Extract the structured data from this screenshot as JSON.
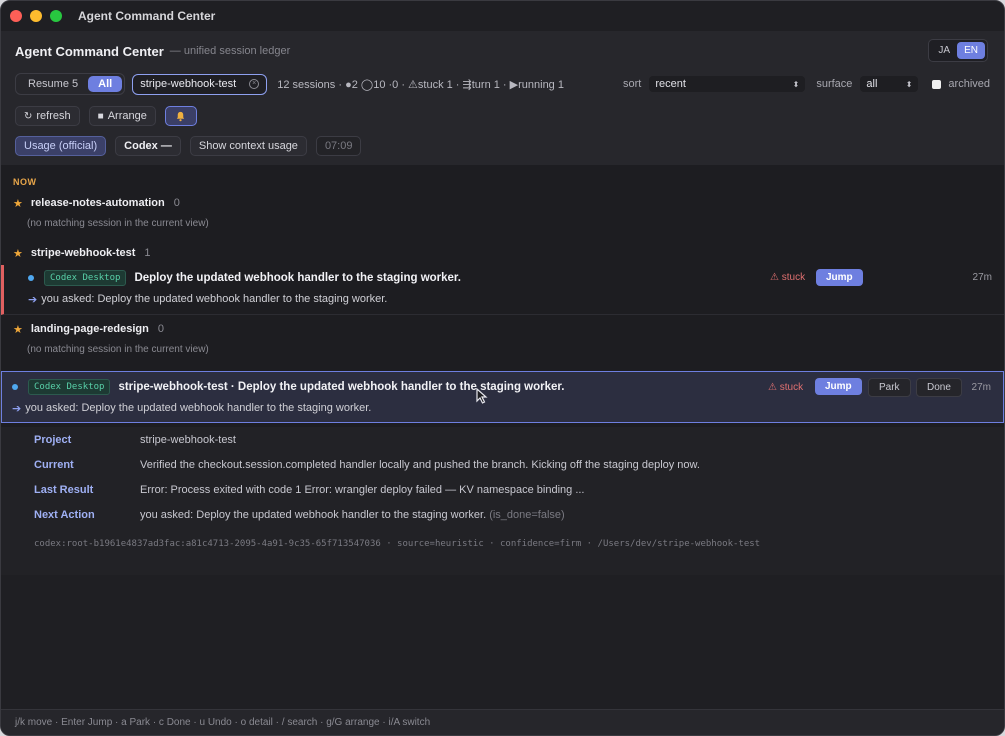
{
  "window": {
    "title": "Agent Command Center"
  },
  "header": {
    "title": "Agent Command Center",
    "subtitle": "— unified session ledger",
    "lang": [
      "JA",
      "EN"
    ],
    "lang_active": "EN"
  },
  "filters": {
    "resume_label": "Resume 5",
    "all_label": "All",
    "search_value": "stripe-webhook-test",
    "stats": "12 sessions · ●2 ◯10 ·0 · ⚠stuck 1 · ⇶turn 1 · ▶running 1",
    "sort_label": "sort",
    "sort_value": "recent",
    "surface_label": "surface",
    "surface_value": "all",
    "archived_label": "archived"
  },
  "toolbar": {
    "refresh_label": "refresh",
    "arrange_label": "Arrange",
    "bell_icon": "bell-icon"
  },
  "usage": {
    "usage_label": "Usage (official)",
    "codex_label": "Codex —",
    "context_label": "Show context usage",
    "time_label": "07:09"
  },
  "list": {
    "section": "NOW",
    "projects": [
      {
        "name": "release-notes-automation",
        "count": "0",
        "empty": "(no matching session in the current view)"
      },
      {
        "name": "stripe-webhook-test",
        "count": "1"
      },
      {
        "name": "landing-page-redesign",
        "count": "0",
        "empty": "(no matching session in the current view)"
      }
    ],
    "session1": {
      "tag": "Codex Desktop",
      "title": "Deploy the updated webhook handler to the staging worker.",
      "stuck": "⚠ stuck",
      "jump": "Jump",
      "age": "27m",
      "asked": "you asked: Deploy the updated webhook handler to the staging worker."
    },
    "session2": {
      "tag": "Codex Desktop",
      "title": "stripe-webhook-test · Deploy the updated webhook handler to the staging worker.",
      "stuck": "⚠ stuck",
      "jump": "Jump",
      "park": "Park",
      "done": "Done",
      "age": "27m",
      "asked": "you asked: Deploy the updated webhook handler to the staging worker."
    }
  },
  "detail": {
    "project_label": "Project",
    "project_value": "stripe-webhook-test",
    "current_label": "Current",
    "current_value": "Verified the checkout.session.completed handler locally and pushed the branch. Kicking off the staging deploy now.",
    "last_label": "Last Result",
    "last_value": "Error: Process exited with code 1 Error: wrangler deploy failed — KV namespace binding ...",
    "next_label": "Next Action",
    "next_value": "you asked: Deploy the updated webhook handler to the staging worker.",
    "next_suffix": "(is_done=false)",
    "meta": "codex:root-b1961e4837ad3fac:a81c4713-2095-4a91-9c35-65f713547036 · source=heuristic · confidence=firm · /Users/dev/stripe-webhook-test"
  },
  "footer": {
    "hints": "j/k move · Enter Jump · a Park · c Done · u Undo · o detail · / search · g/G arrange · i/A switch"
  },
  "colors": {
    "accent": "#6e7fe0",
    "stuck": "#e07070",
    "now": "#e8a64a",
    "tag": "#58d0a8"
  }
}
